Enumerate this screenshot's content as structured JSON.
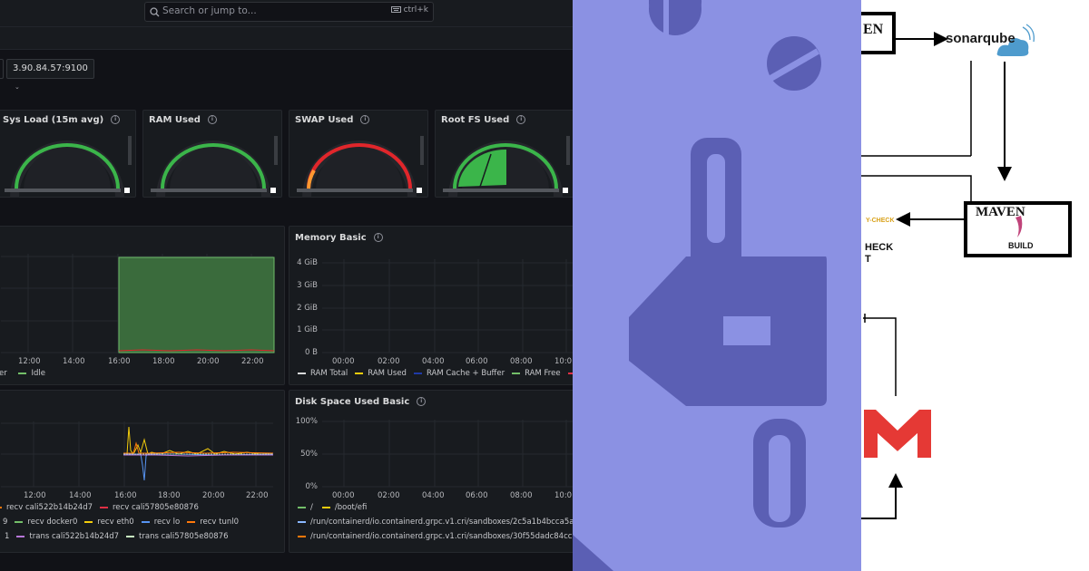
{
  "search": {
    "placeholder": "Search or jump to...",
    "shortcut": "ctrl+k"
  },
  "instance": {
    "value": "3.90.84.57:9100"
  },
  "gauges": [
    {
      "title": "Sys Load (15m avg)",
      "color": "#3bb54a"
    },
    {
      "title": "RAM Used",
      "color": "#3bb54a"
    },
    {
      "title": "SWAP Used",
      "color": "#e0262b"
    },
    {
      "title": "Root FS Used",
      "color": "#3bb54a"
    }
  ],
  "cpu_panel": {
    "x_ticks": [
      "12:00",
      "14:00",
      "16:00",
      "18:00",
      "20:00",
      "22:00"
    ],
    "legend": [
      "er",
      "Idle"
    ]
  },
  "memory_panel": {
    "title": "Memory Basic",
    "y_ticks": [
      "4 GiB",
      "3 GiB",
      "2 GiB",
      "1 GiB",
      "0 B"
    ],
    "x_ticks": [
      "00:00",
      "02:00",
      "04:00",
      "06:00",
      "08:00",
      "10:0"
    ],
    "legend": [
      {
        "label": "RAM Total",
        "color": "#d8d9da"
      },
      {
        "label": "RAM Used",
        "color": "#f2cc0c"
      },
      {
        "label": "RAM Cache + Buffer",
        "color": "#1f3aa8"
      },
      {
        "label": "RAM Free",
        "color": "#73bf69"
      },
      {
        "label": "S",
        "color": "#e02f44"
      }
    ]
  },
  "network_panel": {
    "x_ticks": [
      "12:00",
      "14:00",
      "16:00",
      "18:00",
      "20:00",
      "22:00"
    ],
    "legend_rows": [
      [
        {
          "label": "recv cali522b14b24d7",
          "color": "#ff780a"
        },
        {
          "label": "recv cali57805e80876",
          "color": "#e02f44"
        }
      ],
      [
        {
          "label": "9",
          "color": "#8ab8ff"
        },
        {
          "label": "recv docker0",
          "color": "#73bf69"
        },
        {
          "label": "recv eth0",
          "color": "#f2cc0c"
        },
        {
          "label": "recv lo",
          "color": "#5794f2"
        },
        {
          "label": "recv tunl0",
          "color": "#ff780a"
        }
      ],
      [
        {
          "label": "1",
          "color": "#b877d9"
        },
        {
          "label": "trans cali522b14b24d7",
          "color": "#b877d9"
        },
        {
          "label": "trans cali57805e80876",
          "color": "#c8f2c2"
        }
      ]
    ]
  },
  "disk_panel": {
    "title": "Disk Space Used Basic",
    "y_ticks": [
      "100%",
      "50%",
      "0%"
    ],
    "x_ticks": [
      "00:00",
      "02:00",
      "04:00",
      "06:00",
      "08:00",
      "10:0"
    ],
    "legend_row1": [
      {
        "label": "/",
        "color": "#73bf69"
      },
      {
        "label": "/boot/efi",
        "color": "#f2cc0c"
      }
    ],
    "legend_paths": [
      {
        "label": "/run/containerd/io.containerd.grpc.v1.cri/sandboxes/2c5a1b4bcca5a57a1",
        "color": "#8ab8ff"
      },
      {
        "label": "/run/containerd/io.containerd.grpc.v1.cri/sandboxes/30f55dadc84cc7b88",
        "color": "#ff780a"
      }
    ]
  },
  "diagram": {
    "maven_top": "EN",
    "sonarqube": "sonarqube",
    "maven_box": "MAVEN",
    "build": "BUILD",
    "check_badge": "Y-CHECK",
    "check_line1": "HECK",
    "check_line2": "T"
  }
}
